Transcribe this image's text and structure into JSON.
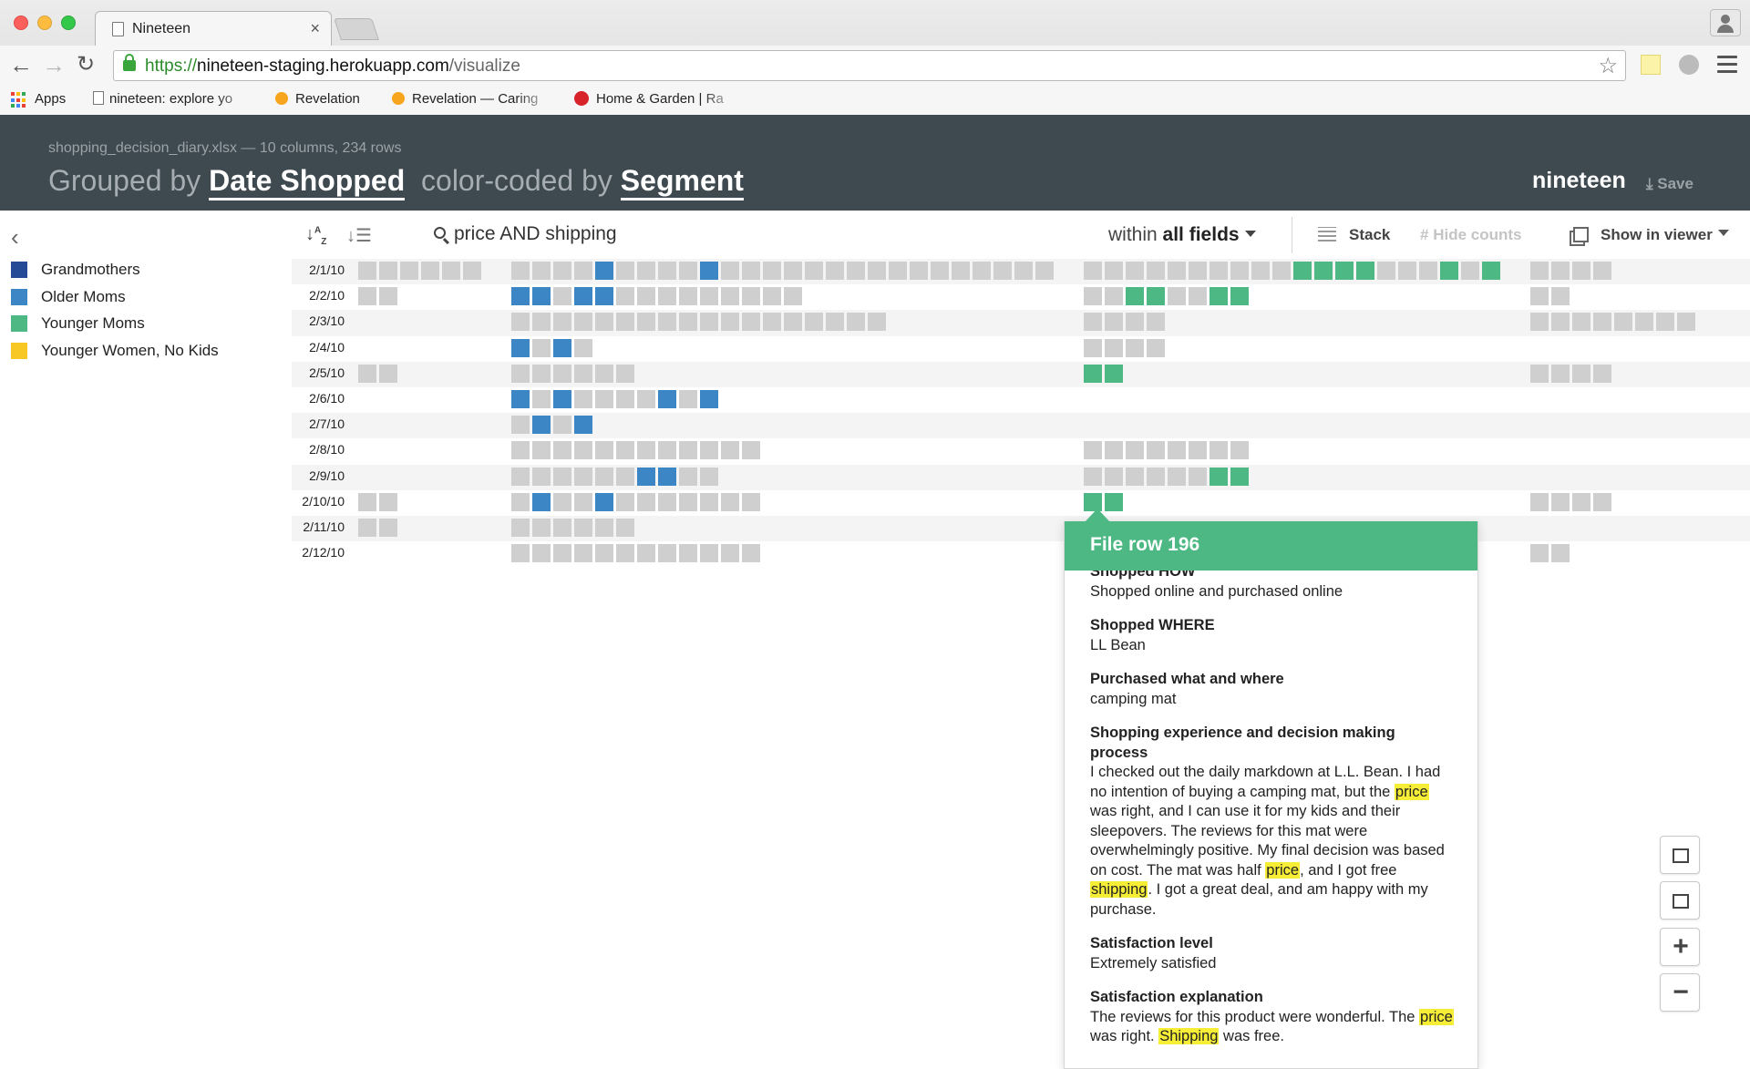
{
  "browser": {
    "tab_title": "Nineteen",
    "url_scheme": "https://",
    "url_host": "nineteen-staging.herokuapp.com",
    "url_path": "/visualize",
    "bookmarks": [
      "Apps",
      "nineteen: explore yo",
      "Revelation",
      "Revelation — Caring",
      "Home & Garden | Ra"
    ]
  },
  "header": {
    "file_meta": "shopping_decision_diary.xlsx — 10 columns, 234 rows",
    "grouped_prefix": "Grouped by",
    "group_field": "Date Shopped",
    "color_prefix": "color-coded by",
    "color_field": "Segment",
    "brand": "nineteen",
    "save_label": "Save"
  },
  "legend": [
    {
      "label": "Grandmothers",
      "color": "#264b96"
    },
    {
      "label": "Older Moms",
      "color": "#3d86c6"
    },
    {
      "label": "Younger Moms",
      "color": "#4db883"
    },
    {
      "label": "Younger Women, No Kids",
      "color": "#f7c823"
    }
  ],
  "controls": {
    "search_query": "price AND shipping",
    "scope_prefix": "within",
    "scope_field": "all fields",
    "stack_label": "Stack",
    "hide_counts_label": "Hide counts",
    "show_in_viewer_label": "Show in viewer"
  },
  "grid": {
    "unmatched_color": "#cfcfcf",
    "groups": [
      {
        "count": 6
      },
      {
        "count": 26
      },
      {
        "count": 20
      },
      {
        "count": 4
      }
    ],
    "rows": [
      {
        "date": "2/1/10",
        "cells": [
          [
            0,
            0,
            0,
            0,
            0,
            0
          ],
          [
            0,
            0,
            0,
            0,
            2,
            0,
            0,
            0,
            0,
            2,
            0,
            0,
            0,
            0,
            0,
            0,
            0,
            0,
            0,
            0,
            0,
            0,
            0,
            0,
            0,
            0
          ],
          [
            0,
            0,
            0,
            0,
            0,
            0,
            0,
            0,
            0,
            0,
            3,
            3,
            3,
            3,
            0,
            0,
            0,
            3,
            0,
            3
          ],
          [
            0,
            0,
            0,
            0
          ]
        ]
      },
      {
        "date": "2/2/10",
        "cells": [
          [
            0,
            0
          ],
          [
            2,
            2,
            0,
            2,
            2,
            0,
            0,
            0,
            0,
            0,
            0,
            0,
            0,
            0
          ],
          [
            0,
            0,
            3,
            3,
            0,
            0,
            3,
            3
          ],
          [
            0,
            0
          ]
        ]
      },
      {
        "date": "2/3/10",
        "cells": [
          [],
          [
            0,
            0,
            0,
            0,
            0,
            0,
            0,
            0,
            0,
            0,
            0,
            0,
            0,
            0,
            0,
            0,
            0,
            0
          ],
          [
            0,
            0,
            0,
            0
          ],
          [
            0,
            0,
            0,
            0,
            0,
            0,
            0,
            0
          ]
        ]
      },
      {
        "date": "2/4/10",
        "cells": [
          [],
          [
            2,
            0,
            2,
            0
          ],
          [
            0,
            0,
            0,
            0
          ],
          []
        ]
      },
      {
        "date": "2/5/10",
        "cells": [
          [
            0,
            0
          ],
          [
            0,
            0,
            0,
            0,
            0,
            0
          ],
          [
            3,
            3
          ],
          [
            0,
            0,
            0,
            0
          ]
        ]
      },
      {
        "date": "2/6/10",
        "cells": [
          [],
          [
            2,
            0,
            2,
            0,
            0,
            0,
            0,
            2,
            0,
            2
          ],
          [],
          []
        ]
      },
      {
        "date": "2/7/10",
        "cells": [
          [],
          [
            0,
            2,
            0,
            2
          ],
          [],
          []
        ]
      },
      {
        "date": "2/8/10",
        "cells": [
          [],
          [
            0,
            0,
            0,
            0,
            0,
            0,
            0,
            0,
            0,
            0,
            0,
            0
          ],
          [
            0,
            0,
            0,
            0,
            0,
            0,
            0,
            0
          ],
          []
        ]
      },
      {
        "date": "2/9/10",
        "cells": [
          [],
          [
            0,
            0,
            0,
            0,
            0,
            0,
            2,
            2,
            0,
            0
          ],
          [
            0,
            0,
            0,
            0,
            0,
            0,
            3,
            3
          ],
          []
        ]
      },
      {
        "date": "2/10/10",
        "cells": [
          [
            0,
            0
          ],
          [
            0,
            2,
            0,
            0,
            2,
            0,
            0,
            0,
            0,
            0,
            0,
            0
          ],
          [
            3,
            3
          ],
          [
            0,
            0,
            0,
            0
          ]
        ]
      },
      {
        "date": "2/11/10",
        "cells": [
          [
            0,
            0
          ],
          [
            0,
            0,
            0,
            0,
            0,
            0
          ],
          [],
          []
        ]
      },
      {
        "date": "2/12/10",
        "cells": [
          [],
          [
            0,
            0,
            0,
            0,
            0,
            0,
            0,
            0,
            0,
            0,
            0,
            0
          ],
          [],
          [
            0,
            0
          ]
        ]
      }
    ]
  },
  "popup": {
    "title": "File row 196",
    "fields": [
      {
        "label": "Shopped HOW",
        "value": [
          {
            "t": "Shopped online and purchased online"
          }
        ]
      },
      {
        "label": "Shopped WHERE",
        "value": [
          {
            "t": "LL Bean"
          }
        ]
      },
      {
        "label": "Purchased what and where",
        "value": [
          {
            "t": "camping mat"
          }
        ]
      },
      {
        "label": "Shopping experience and decision making process",
        "value": [
          {
            "t": "I checked out the daily markdown at L.L. Bean. I had no intention of buying a camping mat, but the "
          },
          {
            "t": "price",
            "hl": true
          },
          {
            "t": " was right, and I can use it for my kids and their sleepovers. The reviews for this mat were overwhelmingly positive. My final decision was based on cost. The mat was half "
          },
          {
            "t": "price",
            "hl": true
          },
          {
            "t": ", and I got free "
          },
          {
            "t": "shipping",
            "hl": true
          },
          {
            "t": ". I got a great deal, and am happy with my purchase."
          }
        ]
      },
      {
        "label": "Satisfaction level",
        "value": [
          {
            "t": "Extremely satisfied"
          }
        ]
      },
      {
        "label": "Satisfaction explanation",
        "value": [
          {
            "t": "The reviews for this product were wonderful. The "
          },
          {
            "t": "price",
            "hl": true
          },
          {
            "t": " was right. "
          },
          {
            "t": "Shipping",
            "hl": true
          },
          {
            "t": " was free."
          }
        ]
      }
    ]
  }
}
